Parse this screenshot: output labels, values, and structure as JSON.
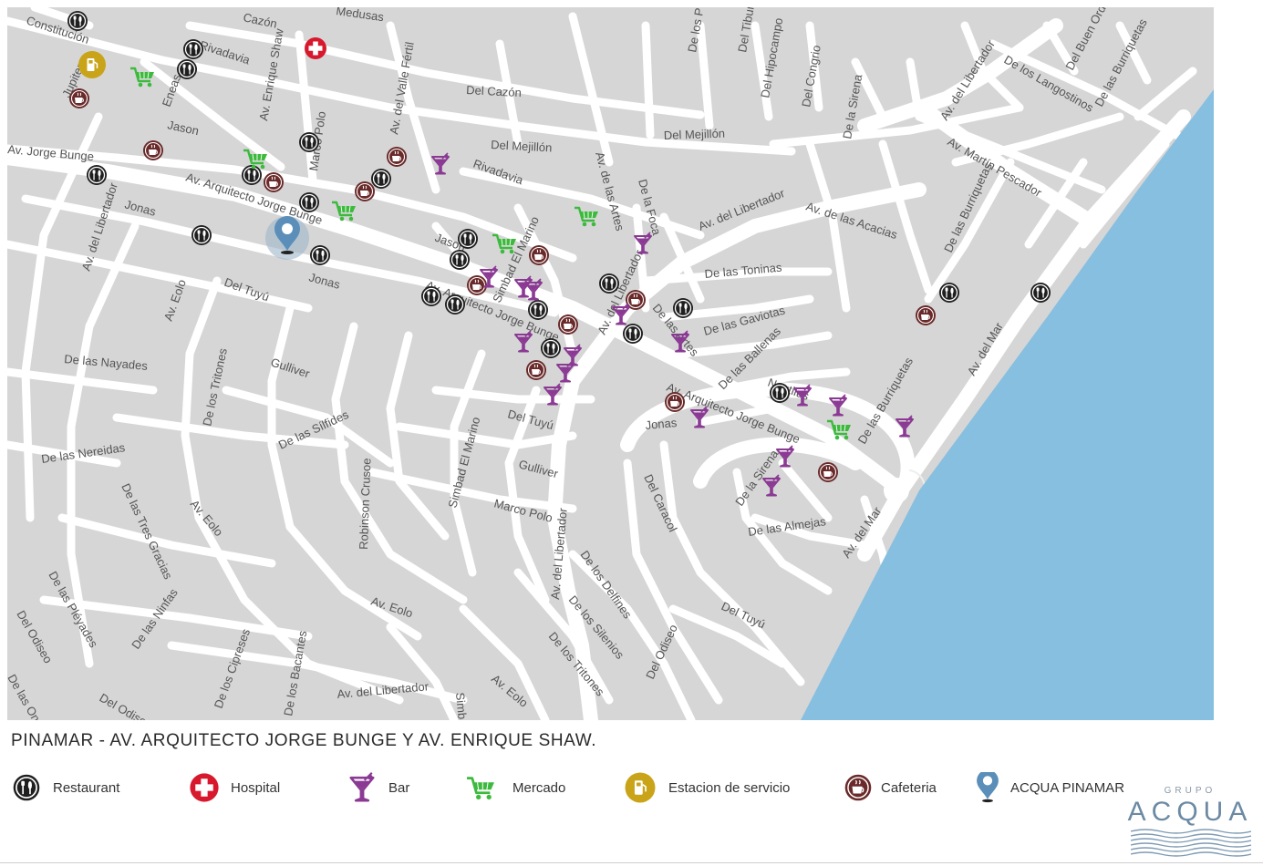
{
  "colors": {
    "land": "#d6d6d6",
    "road": "#ffffff",
    "sea": "#87bfe0",
    "restaurant": "#1f1f1f",
    "hospital": "#d8192d",
    "bar": "#8b3a94",
    "mercado": "#3dba3d",
    "estacion": "#c9a418",
    "cafeteria": "#6a2a2a",
    "acqua": "#5b8fb9"
  },
  "map": {
    "streets": [
      "Constitución",
      "Cazón",
      "Medusas",
      "De los P",
      "Del Tiburón",
      "Del Hipocampo",
      "Del Congrio",
      "De la Sirena",
      "Av. del Libertador",
      "De los Langostinos",
      "Del Buen Orden",
      "De las Burriquetas",
      "Rivadavia",
      "Av. Enrique Shaw",
      "Av. del Valle Fértil",
      "Del Cazón",
      "Eneas",
      "Jupiter",
      "Jason",
      "Av. Jorge Bunge",
      "Del Mejillón",
      "Av. Martín Pescador",
      "Av. Arquitecto Jorge Bunge",
      "Marco Polo",
      "Av. de las Artes",
      "De la Foca",
      "Av. de las Acacias",
      "Jonas",
      "Simbad El Marino",
      "De las Toninas",
      "Del Tuyú",
      "De las Artes",
      "De las Gaviotas",
      "Av. Eolo",
      "De las Ballenas",
      "Av. del Mar",
      "De las Nayades",
      "De los Tritones",
      "Gulliver",
      "Nautilus",
      "De las Sílfides",
      "De las Nereidas",
      "Robinson Crusoe",
      "Del Caracol",
      "De las Tres Gracias",
      "De la Sirena",
      "De las Almejas",
      "De las Pléyades",
      "De las Ninfas",
      "De los Delfines",
      "Del Odiseo",
      "De los Silenios",
      "De los Cipreses",
      "De los Bacantes",
      "Simbad",
      "De las Ondinas",
      "Del Odiseo"
    ]
  },
  "caption": "PINAMAR - AV. ARQUITECTO JORGE BUNGE Y AV. ENRIQUE SHAW.",
  "legend": [
    {
      "icon": "restaurant-icon",
      "label": "Restaurant"
    },
    {
      "icon": "hospital-icon",
      "label": "Hospital"
    },
    {
      "icon": "bar-icon",
      "label": "Bar"
    },
    {
      "icon": "mercado-icon",
      "label": "Mercado"
    },
    {
      "icon": "estacion-icon",
      "label": "Estacion de servicio"
    },
    {
      "icon": "cafeteria-icon",
      "label": "Cafeteria"
    },
    {
      "icon": "acqua-pin-icon",
      "label": "ACQUA PINAMAR"
    }
  ],
  "brand": {
    "top": "GRUPO",
    "name": "ACQUA"
  }
}
